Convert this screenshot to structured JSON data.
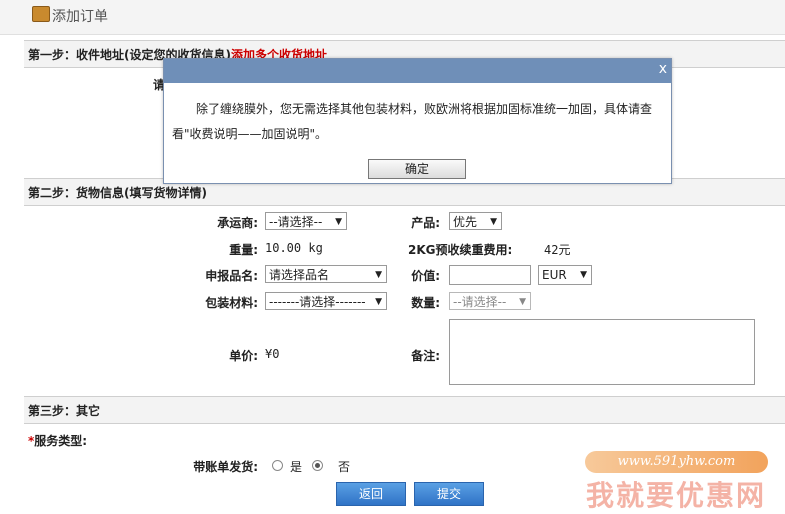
{
  "header": {
    "title": "添加订单"
  },
  "step1": {
    "title": "第一步：收件地址(设定您的收货信息)",
    "link": "添加多个收货地址",
    "partial_label": "请"
  },
  "modal": {
    "close": "x",
    "message": "除了缠绕膜外，您无需选择其他包装材料，败欧洲将根据加固标准统一加固，具体请查看\"收费说明——加固说明\"。",
    "ok_label": "确定"
  },
  "step2": {
    "title": "第二步：货物信息(填写货物详情)",
    "carrier_label": "承运商:",
    "carrier_value": "--请选择--",
    "product_label": "产品:",
    "product_value": "优先",
    "weight_label": "重量:",
    "weight_value": "10.00 kg",
    "fee_label": "2KG预收续重费用:",
    "fee_value": "42元",
    "declare_label": "申报品名:",
    "declare_value": "请选择品名",
    "price_label": "价值:",
    "price_value": "",
    "currency_value": "EUR",
    "packing_label": "包装材料:",
    "packing_value": "-------请选择-------",
    "qty_label": "数量:",
    "qty_value": "--请选择--",
    "unit_label": "单价:",
    "unit_value": "¥0",
    "remark_label": "备注:"
  },
  "step3": {
    "title": "第三步：其它",
    "service_star": "*",
    "service_label": "服务类型:",
    "bill_label": "带账单发货:",
    "yes_label": "是",
    "no_label": "否",
    "back_label": "返回",
    "submit_label": "提交"
  },
  "watermark": {
    "url": "www.591yhw.com",
    "name": "我就要优惠网"
  }
}
